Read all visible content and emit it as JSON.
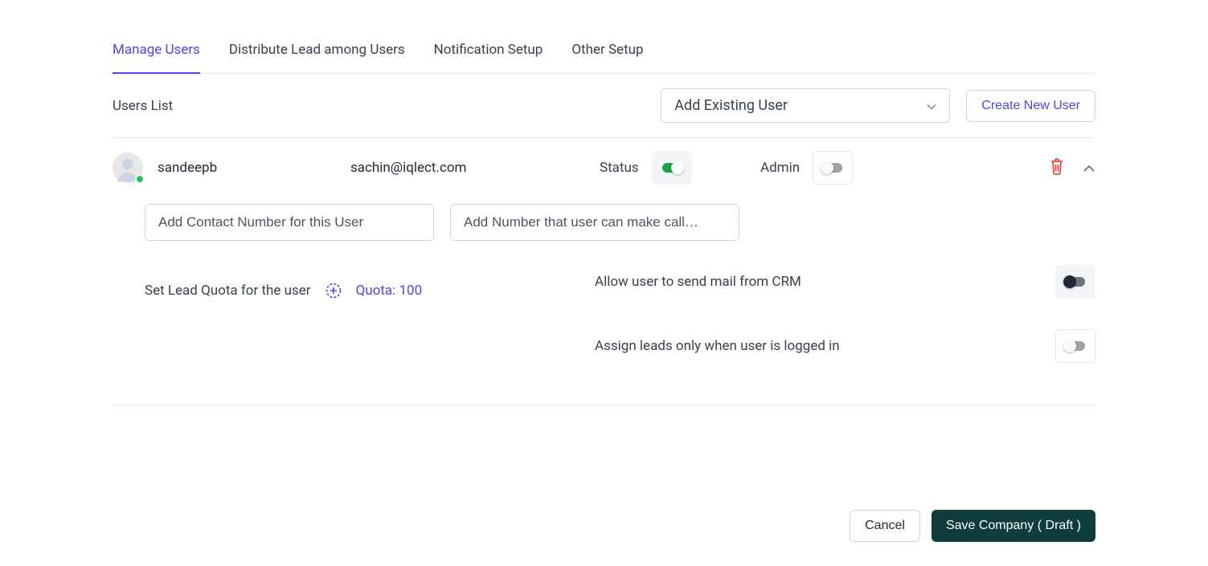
{
  "tabs": [
    {
      "label": "Manage Users",
      "active": true
    },
    {
      "label": "Distribute Lead among Users",
      "active": false
    },
    {
      "label": "Notification Setup",
      "active": false
    },
    {
      "label": "Other Setup",
      "active": false
    }
  ],
  "section_title": "Users List",
  "add_existing": {
    "selected": "Add Existing User"
  },
  "create_new_label": "Create New User",
  "user": {
    "name": "sandeepb",
    "email": "sachin@iqlect.com",
    "status_label": "Status",
    "status_on": true,
    "admin_label": "Admin",
    "admin_on": false,
    "presence": "online"
  },
  "inputs": {
    "contact_placeholder": "Add Contact Number for this User",
    "call_placeholder": "Add Number that user can make call…"
  },
  "quota": {
    "label": "Set Lead Quota for the user",
    "value_text": "Quota: 100"
  },
  "settings": {
    "mail": {
      "label": "Allow user to send mail from CRM",
      "on": false,
      "dark": true
    },
    "assign": {
      "label": "Assign leads only when user is logged in",
      "on": false,
      "dark": false
    }
  },
  "footer": {
    "cancel": "Cancel",
    "save": "Save Company ( Draft )"
  },
  "colors": {
    "accent": "#4f46e5",
    "success": "#16a34a",
    "danger": "#ef4444",
    "dark": "#0f3d3d"
  }
}
